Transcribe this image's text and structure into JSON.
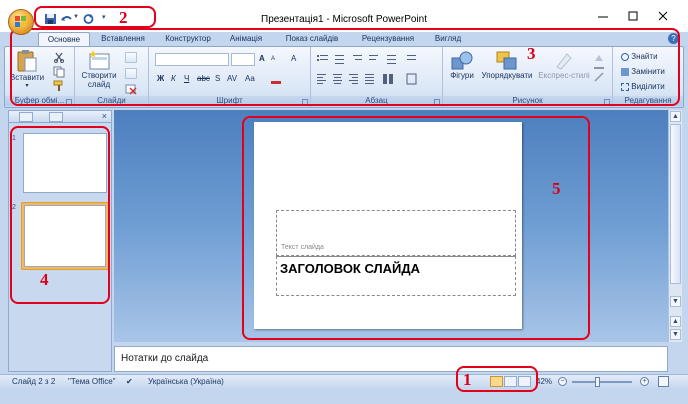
{
  "window": {
    "title": "Презентація1 - Microsoft PowerPoint"
  },
  "tabs": [
    {
      "label": "Основне",
      "active": true
    },
    {
      "label": "Вставлення"
    },
    {
      "label": "Конструктор"
    },
    {
      "label": "Анімація"
    },
    {
      "label": "Показ слайдів"
    },
    {
      "label": "Рецензування"
    },
    {
      "label": "Вигляд"
    }
  ],
  "ribbon": {
    "clipboard": {
      "paste_label": "Вставити",
      "group_label": "Буфер обмі..."
    },
    "slides": {
      "new_slide_line1": "Створити",
      "new_slide_line2": "слайд",
      "group_label": "Слайди"
    },
    "font": {
      "group_label": "Шрифт",
      "bold": "Ж",
      "italic": "К",
      "underline": "Ч",
      "strike": "abc",
      "shadow": "S",
      "spacing": "AV",
      "case": "Aa",
      "grow": "A",
      "shrink": "A",
      "clear": "A"
    },
    "paragraph": {
      "group_label": "Абзац"
    },
    "drawing": {
      "shapes_label": "Фігури",
      "arrange_label": "Упорядкувати",
      "quick_styles_label": "Експрес-стилі",
      "group_label": "Рисунок"
    },
    "editing": {
      "find_label": "Знайти",
      "replace_label": "Замінити",
      "select_label": "Виділити",
      "group_label": "Редагування"
    }
  },
  "slides_pane": {
    "thumbnails": [
      {
        "number": "1"
      },
      {
        "number": "2",
        "selected": true
      }
    ]
  },
  "slide": {
    "text_placeholder": "Текст слайда",
    "title_placeholder": "ЗАГОЛОВОК СЛАЙДА"
  },
  "notes": {
    "placeholder": "Нотатки до слайда"
  },
  "status": {
    "slide_info": "Слайд 2 з 2",
    "theme": "\"Тема Office\"",
    "language": "Українська (Україна)",
    "zoom": "42%"
  },
  "annotations": {
    "n1": "1",
    "n2": "2",
    "n3": "3",
    "n4": "4",
    "n5": "5"
  },
  "colors": {
    "annotation": "#e3001b",
    "ribbon_bg": "#dbe7f6",
    "edit_area": "#5b8cc8",
    "selected_thumb": "#f6b957"
  }
}
